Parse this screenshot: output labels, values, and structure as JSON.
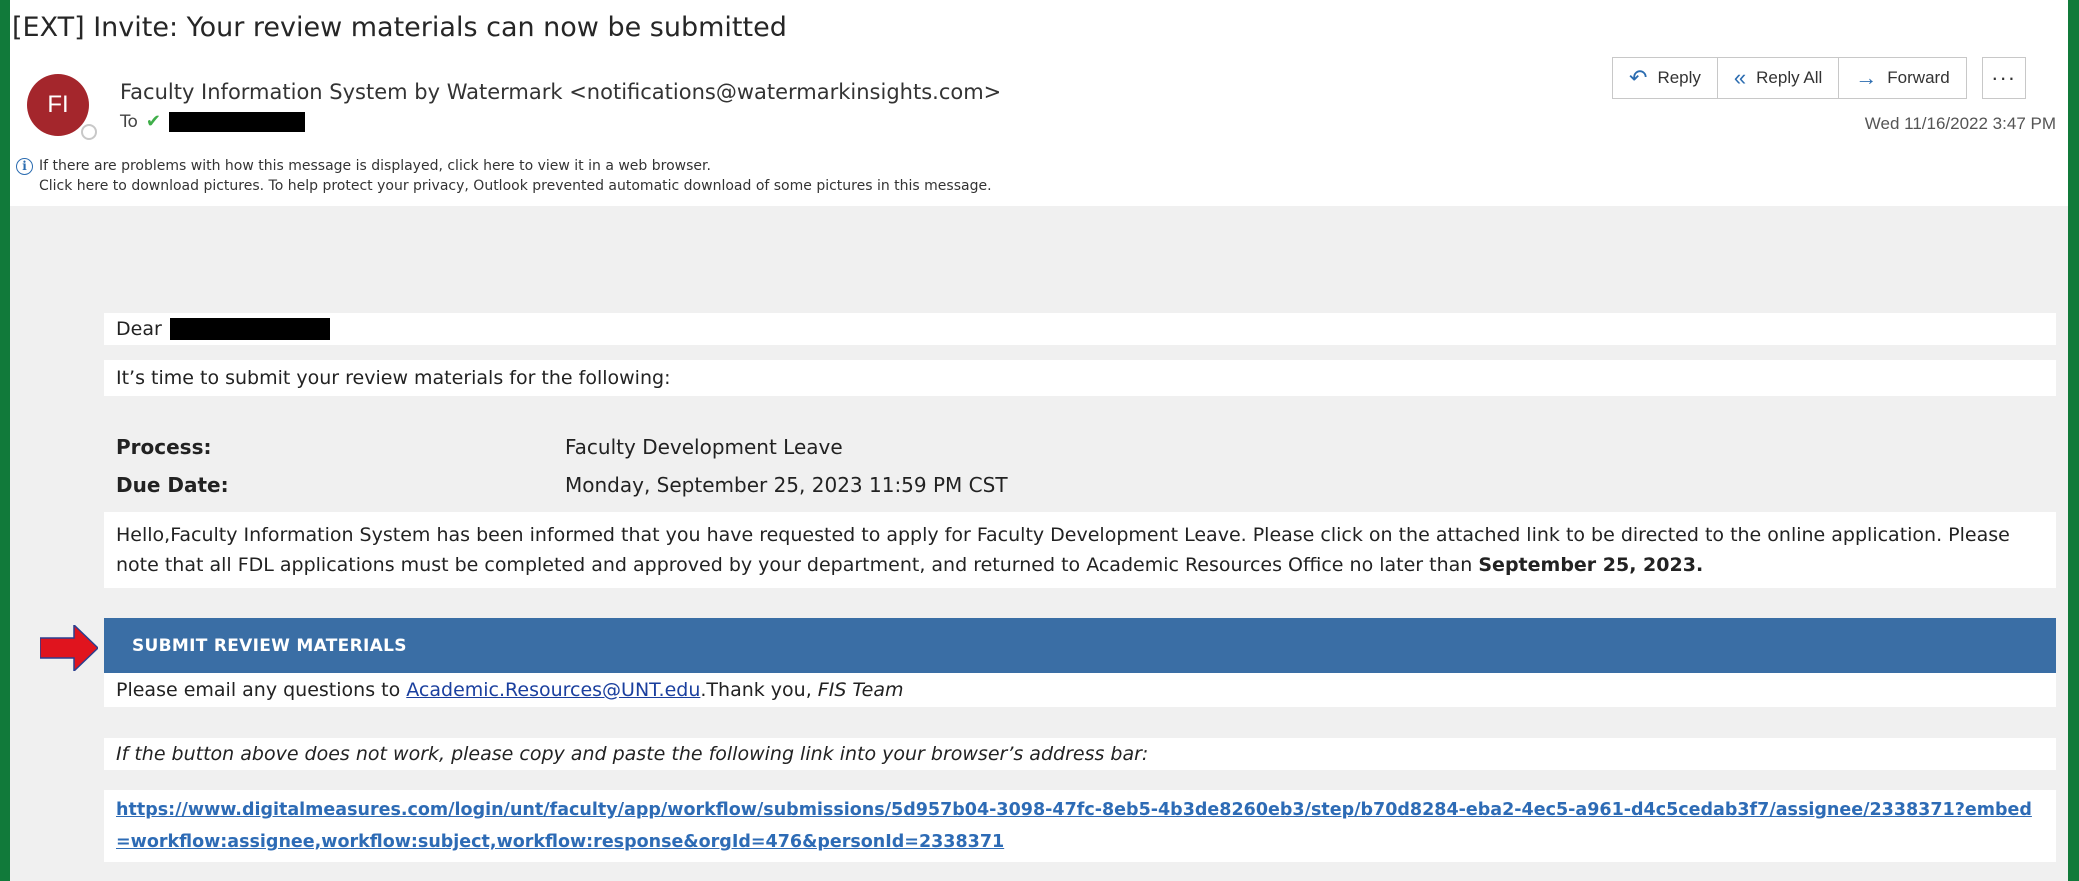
{
  "email": {
    "subject": "[EXT] Invite: Your review materials can now be submitted",
    "sender_initials": "FI",
    "sender": "Faculty Information System by Watermark <notifications@watermarkinsights.com>",
    "to_label": "To",
    "date": "Wed 11/16/2022 3:47 PM"
  },
  "actions": {
    "reply": "Reply",
    "reply_all": "Reply All",
    "forward": "Forward",
    "more": "···"
  },
  "info_bar": {
    "line1": "If there are problems with how this message is displayed, click here to view it in a web browser.",
    "line2": "Click here to download pictures. To help protect your privacy, Outlook prevented automatic download of some pictures in this message."
  },
  "body": {
    "greeting": "Dear",
    "intro": "It’s time to submit your review materials for the following:",
    "process_label": "Process:",
    "process_value": "Faculty Development Leave",
    "due_label": "Due Date:",
    "due_value": "Monday, September 25, 2023 11:59 PM CST",
    "paragraph": "Hello,Faculty Information System has been informed that you have requested to apply for Faculty Development Leave. Please click on the attached link to be directed to the online application. Please note that all FDL applications must be completed and approved by your department, and returned to Academic Resources Office no later than ",
    "paragraph_bold": "September 25, 2023.",
    "submit_button": "SUBMIT REVIEW MATERIALS",
    "questions_prefix": "Please email any questions to ",
    "questions_email": "Academic.Resources@UNT.edu",
    "questions_suffix": ".Thank you, ",
    "questions_sign": "FIS Team",
    "fallback": "If the button above does not work, please copy and paste the following link into your browser’s address bar:",
    "link": "https://www.digitalmeasures.com/login/unt/faculty/app/workflow/submissions/5d957b04-3098-47fc-8eb5-4b3de8260eb3/step/b70d8284-eba2-4ec5-a961-d4c5cedab3f7/assignee/2338371?embed=workflow:assignee,workflow:subject,workflow:response&orgId=476&personId=2338371"
  },
  "colors": {
    "frame": "#117a3a",
    "avatar": "#a4262c",
    "banner": "#3a6ea5",
    "arrow": "#e0141e"
  },
  "icons": [
    "reply-icon",
    "reply-all-icon",
    "forward-icon",
    "info-icon",
    "presence-icon",
    "check-icon",
    "arrow-icon"
  ]
}
